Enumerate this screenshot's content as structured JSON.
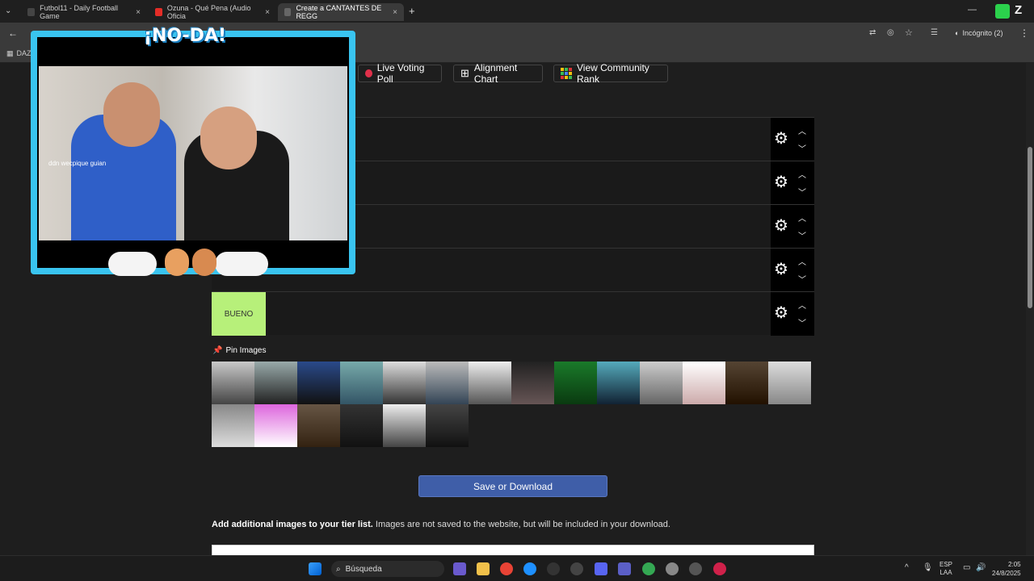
{
  "browser": {
    "tabs": [
      {
        "label": "Futbol11 - Daily Football Game",
        "active": false
      },
      {
        "label": "Ozuna - Qué Pena (Audio Oficia",
        "active": false
      },
      {
        "label": "Create a CANTANTES DE REGG",
        "active": true
      }
    ],
    "new_tab": "+",
    "incognito_label": "Incógnito (2)",
    "bookmark_label": "DAZ"
  },
  "page": {
    "buttons": {
      "live_voting": "Live Voting Poll",
      "alignment": "Alignment Chart",
      "community_rank": "View Community Rank"
    },
    "tiers": [
      {
        "label": ""
      },
      {
        "label": ""
      },
      {
        "label": ""
      },
      {
        "label": ""
      },
      {
        "label": "BUENO",
        "color": "#b7f07a"
      }
    ],
    "pin_images": "Pin Images",
    "save_button": "Save or Download",
    "additional_bold": "Add additional images to your tier list.",
    "additional_text": "Images are not saved to the website, but will be included in your download."
  },
  "overlay": {
    "title": "¡NO-DA!",
    "mirror_text": "ddn wecpique guian"
  },
  "taskbar": {
    "search": "Búsqueda",
    "lang_top": "ESP",
    "lang_bottom": "LAA",
    "time": "2:05",
    "date": "24/8/2025"
  },
  "colors": {
    "accent": "#3f5ea8",
    "overlay_border": "#39c4f0",
    "tier_bueno": "#b7f07a"
  }
}
